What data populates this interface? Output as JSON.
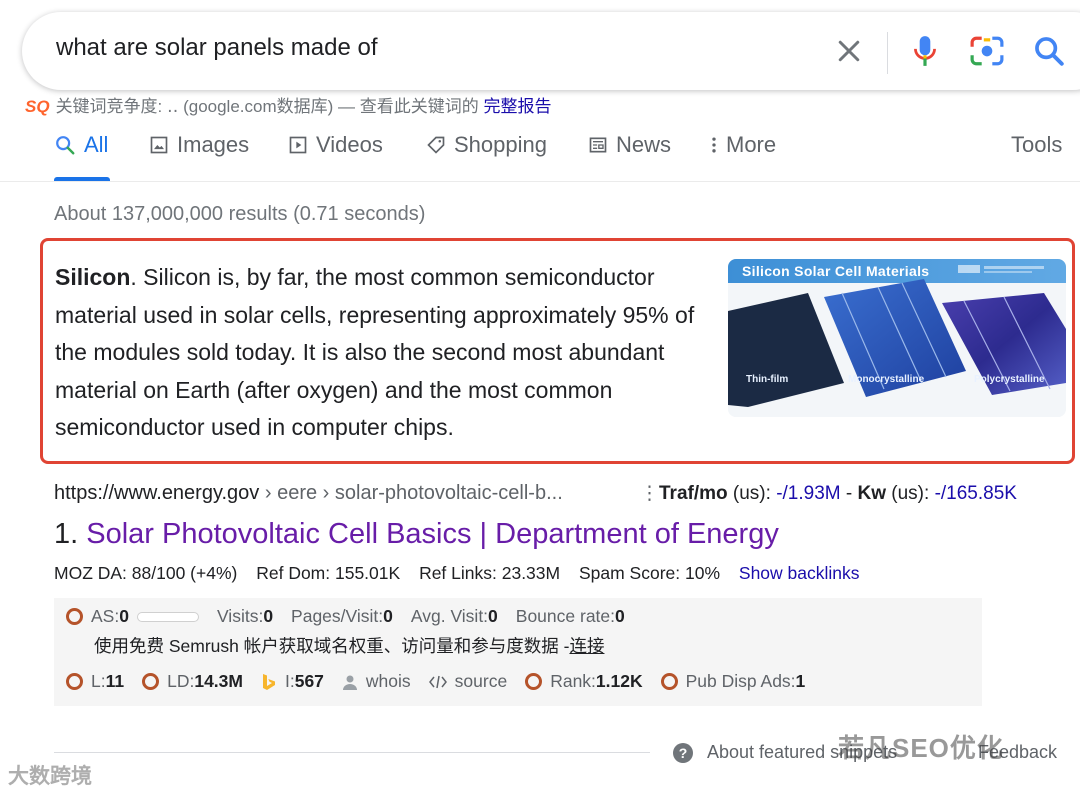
{
  "search": {
    "query": "what are solar panels made of"
  },
  "keyword_line": {
    "badge": "SQ",
    "prefix": "关键词竞争度: ‥ (google.com数据库) — 查看此关键词的",
    "link": "完整报告"
  },
  "tabs": [
    {
      "label": "All",
      "icon": "search-icon",
      "active": true
    },
    {
      "label": "Images",
      "icon": "image-icon"
    },
    {
      "label": "Videos",
      "icon": "play-icon"
    },
    {
      "label": "Shopping",
      "icon": "tag-icon"
    },
    {
      "label": "News",
      "icon": "newspaper-icon"
    },
    {
      "label": "More",
      "icon": "more-vert-icon"
    },
    {
      "label": "Tools"
    }
  ],
  "result_stats": "About 137,000,000 results (0.71 seconds)",
  "featured_snippet": {
    "bold": "Silicon",
    "text": ". Silicon is, by far, the most common semiconductor material used in solar cells, representing approximately 95% of the modules sold today. It is also the second most abundant material on Earth (after oxygen) and the most common semiconductor used in computer chips.",
    "image_title": "Silicon Solar Cell Materials",
    "image_labels": [
      "Thin-film",
      "Monocrystalline",
      "Polycrystalline"
    ],
    "highlight_color": "#e04434"
  },
  "result": {
    "cite_host": "https://www.energy.gov",
    "cite_path": " › eere › solar-photovoltaic-cell-b...",
    "traf_label": "Traf/mo",
    "traf_us": " (us): ",
    "traf_value": "-/1.93M",
    "kw_label": "Kw",
    "kw_value": "-/165.85K",
    "rank": "1.",
    "title": "Solar Photovoltaic Cell Basics | Department of Energy",
    "moz_da": "MOZ DA: 88/100 (+4%)",
    "ref_dom": "Ref Dom: 155.01K",
    "ref_links": "Ref Links: 23.33M",
    "spam": "Spam Score: 10%",
    "backlinks": "Show backlinks"
  },
  "semrush": {
    "as_label": "AS: ",
    "as_value": "0",
    "visits_label": "Visits: ",
    "visits_value": "0",
    "pages_label": "Pages/Visit: ",
    "pages_value": "0",
    "avg_label": "Avg. Visit: ",
    "avg_value": "0",
    "bounce_label": "Bounce rate: ",
    "bounce_value": "0",
    "cn_text": "使用免费 Semrush 帐户获取域名权重、访问量和参与度数据 - ",
    "cn_link": "连接",
    "l_label": "L: ",
    "l_value": "11",
    "ld_label": "LD: ",
    "ld_value": "14.3M",
    "i_label": "I: ",
    "i_value": "567",
    "whois": "whois",
    "source": "source",
    "rank_label": "Rank: ",
    "rank_value": "1.12K",
    "pub_label": "Pub Disp Ads: ",
    "pub_value": "1"
  },
  "footer": {
    "about": "About featured snippets",
    "feedback": "Feedback"
  },
  "watermarks": {
    "right": "若凡SEO优化",
    "left": "大数跨境"
  }
}
